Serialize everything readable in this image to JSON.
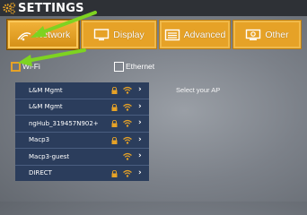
{
  "header": {
    "title": "SETTINGS",
    "icon": "gears-icon"
  },
  "tabs": [
    {
      "label": "Network",
      "icon": "network-icon",
      "active": true
    },
    {
      "label": "Display",
      "icon": "display-icon",
      "active": false
    },
    {
      "label": "Advanced",
      "icon": "advanced-icon",
      "active": false
    },
    {
      "label": "Other",
      "icon": "other-icon",
      "active": false
    }
  ],
  "connection": {
    "wifi": {
      "label": "Wi-Fi",
      "checked": true
    },
    "ethernet": {
      "label": "Ethernet",
      "checked": false
    }
  },
  "ap_list": [
    {
      "name": "L&M Mgmt",
      "locked": true
    },
    {
      "name": "L&M Mgmt",
      "locked": true
    },
    {
      "name": "ngHub_319457N902+",
      "locked": true
    },
    {
      "name": "Macp3",
      "locked": true
    },
    {
      "name": "Macp3-guest",
      "locked": false
    },
    {
      "name": "DIRECT",
      "locked": true
    }
  ],
  "hint": "Select your AP",
  "colors": {
    "accent": "#e6a227",
    "list_bg": "#2b3d5c",
    "annotation_arrow": "#7ed321"
  }
}
